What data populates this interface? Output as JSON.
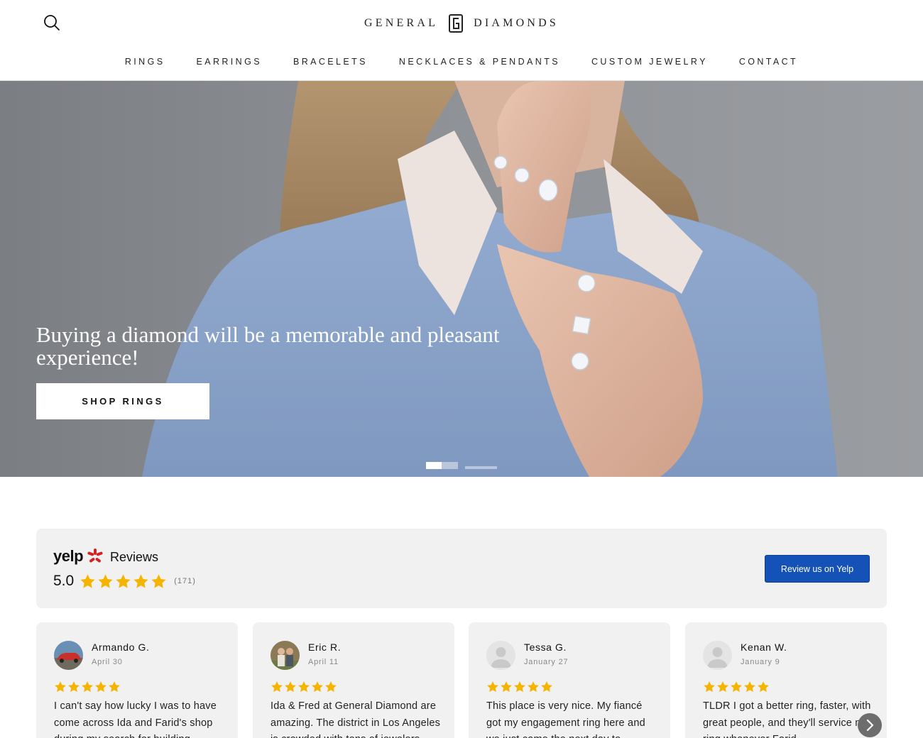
{
  "header": {
    "logo_left": "GENERAL",
    "logo_right": "DIAMONDS",
    "search_icon": "search-icon",
    "nav": [
      {
        "label": "RINGS"
      },
      {
        "label": "EARRINGS"
      },
      {
        "label": "BRACELETS"
      },
      {
        "label": "NECKLACES & PENDANTS"
      },
      {
        "label": "CUSTOM JEWELRY"
      },
      {
        "label": "CONTACT"
      }
    ]
  },
  "hero": {
    "heading": "Buying a diamond will be a memorable and pleasant experience!",
    "button_label": "SHOP RINGS",
    "slides": 2,
    "active_slide": 1
  },
  "yelp": {
    "brand": "yelp",
    "title": "Reviews",
    "rating": "5.0",
    "stars": 5,
    "count": "(171)",
    "button_label": "Review us on Yelp",
    "brand_color": "#d32323",
    "button_color": "#1452b8",
    "star_color": "#f5b400"
  },
  "reviews": [
    {
      "name": "Armando G.",
      "date": "April 30",
      "stars": 5,
      "text": "I can't say how lucky I was to have come across Ida and Farid's shop during my search for building",
      "avatar": "car-photo"
    },
    {
      "name": "Eric R.",
      "date": "April 11",
      "stars": 5,
      "text": "Ida & Fred at General Diamond are amazing. The district in Los Angeles is crowded with tons of jewelers",
      "avatar": "couple-photo"
    },
    {
      "name": "Tessa G.",
      "date": "January 27",
      "stars": 5,
      "text": "This place is very nice. My fiancé got my engagement ring here and we just came the next day to",
      "avatar": "default-user-icon"
    },
    {
      "name": "Kenan W.",
      "date": "January 9",
      "stars": 5,
      "text": "TLDR I got a better ring, faster, with great people, and they'll service my ring whenever Farid",
      "avatar": "default-user-icon"
    }
  ],
  "carousel_next_icon": "chevron-right-icon"
}
